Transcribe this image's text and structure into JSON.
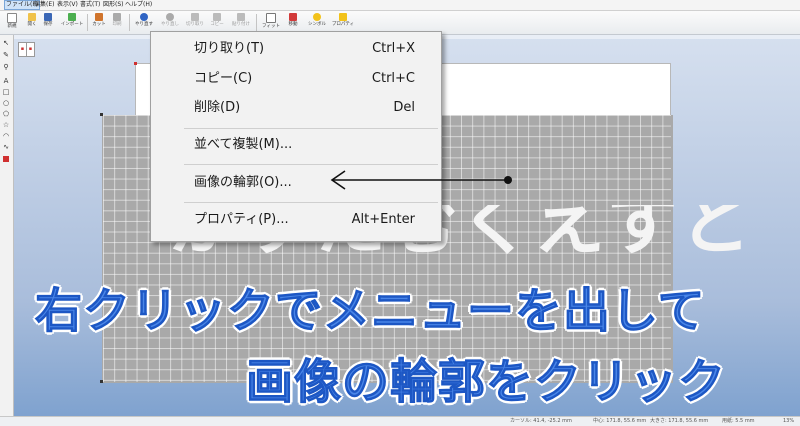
{
  "menubar": {
    "items": [
      "ファイル(F)",
      "編集(E)",
      "表示(V)",
      "書式(T)",
      "図形(S)",
      "ヘルプ(H)"
    ]
  },
  "toolbar": {
    "buttons": [
      "新規",
      "開く",
      "保存",
      "インポート",
      "カット",
      "印刷",
      "やり直す",
      "やり直し",
      "切り取り",
      "コピー",
      "貼り付け",
      "フィット",
      "移動",
      "シンボル",
      "プロパティ"
    ]
  },
  "context_menu": {
    "items": [
      {
        "label": "切り取り(T)",
        "shortcut": "Ctrl+X"
      },
      {
        "label": "コピー(C)",
        "shortcut": "Ctrl+C"
      },
      {
        "label": "削除(D)",
        "shortcut": "Del"
      },
      {
        "label": "並べて複製(M)...",
        "shortcut": ""
      },
      {
        "label": "画像の輪郭(O)...",
        "shortcut": ""
      },
      {
        "label": "プロパティ(P)...",
        "shortcut": "Alt+Enter"
      }
    ]
  },
  "canvas": {
    "big_text": "かすたむくえすと"
  },
  "captions": {
    "line1": "右クリックでメニューを出して",
    "line2": "画像の輪郭をクリック"
  },
  "colors": {
    "caption_fill": "#4a86e8",
    "caption_stroke": "#1d57c4",
    "menu_bg": "#f2f2f2",
    "grid_panel": "#a9a9a9"
  },
  "statusbar": {
    "cursor": "カーソル: 41.4, -25.2 mm",
    "center": "中心: 171.8, 55.6 mm",
    "size": "大きさ: 171.8, 55.6 mm",
    "page": "用紙: 5.5 mm",
    "zoom": "13%"
  }
}
